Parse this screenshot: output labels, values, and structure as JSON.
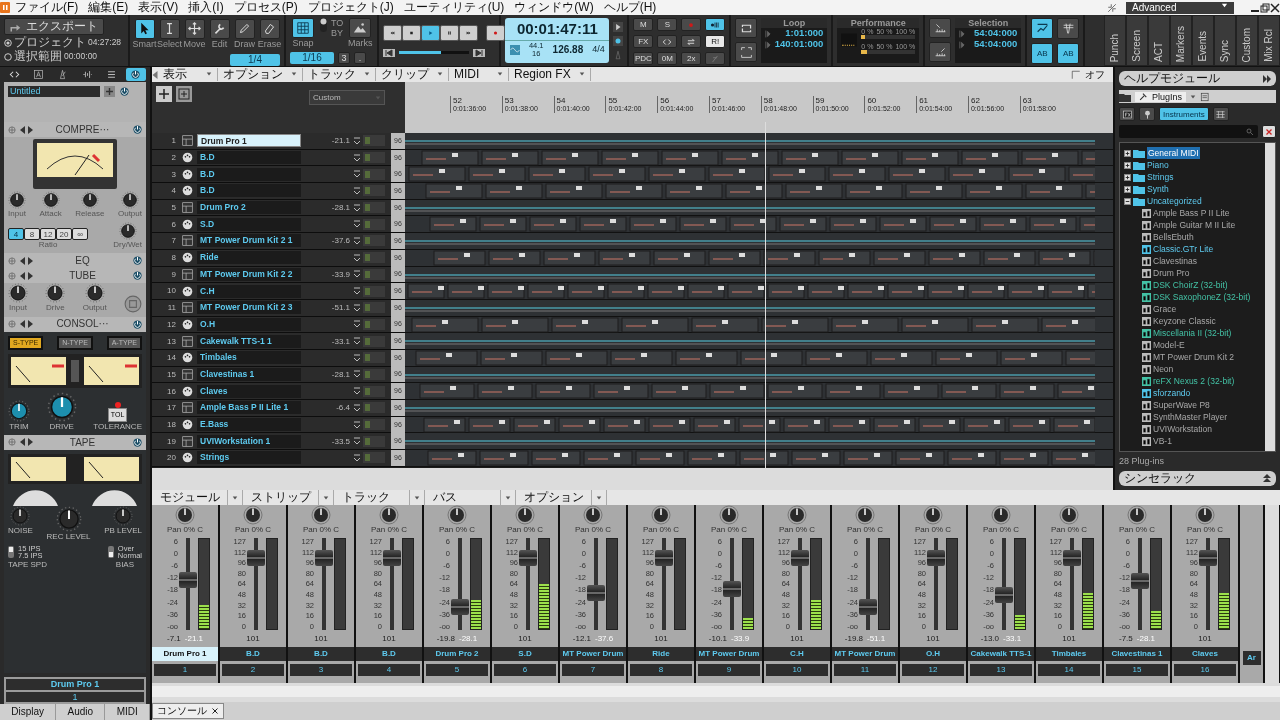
{
  "menu": [
    "ファイル(F)",
    "編集(E)",
    "表示(V)",
    "挿入(I)",
    "プロセス(P)",
    "プロジェクト(J)",
    "ユーティリティ(U)",
    "ウィンドウ(W)",
    "ヘルプ(H)"
  ],
  "workspace": {
    "label": "Advanced"
  },
  "toolbar": {
    "export": {
      "label": "エクスポート",
      "scopes": [
        {
          "label": "プロジェクト",
          "time": "04:27:28",
          "selected": true
        },
        {
          "label": "選択範囲",
          "time": "00:00:00",
          "selected": false
        }
      ]
    },
    "position": {
      "level": 0.6
    },
    "tools": [
      {
        "kind": "pointer",
        "label": "Smart",
        "selected": true
      },
      {
        "kind": "ibeam",
        "label": "Select",
        "selected": false
      },
      {
        "kind": "move",
        "label": "Move",
        "selected": false
      },
      {
        "kind": "wrench",
        "label": "Edit",
        "selected": false
      },
      {
        "kind": "pencil",
        "label": "Draw",
        "selected": false
      },
      {
        "kind": "eraser",
        "label": "Erase",
        "selected": false
      }
    ],
    "tool_resolution": "1/4",
    "snap": {
      "label": "Snap",
      "on": true,
      "to": "TO",
      "by": "BY",
      "by_mode": false,
      "resolution": "1/16",
      "triplet": "3",
      "dotted": ".",
      "marks": "Marks"
    },
    "transport": [
      {
        "kind": "rewind",
        "selected": false
      },
      {
        "kind": "stop",
        "selected": false
      },
      {
        "kind": "play",
        "selected": true
      },
      {
        "kind": "pause",
        "selected": false
      },
      {
        "kind": "forward",
        "selected": false
      }
    ],
    "record": {
      "selected": false
    },
    "now": {
      "time": "00:01:47:11",
      "sample_rate": "44.1",
      "bit_depth": "16",
      "tempo": "126.88",
      "meter": "4/4"
    },
    "mix_buttons": [
      {
        "kind": "text",
        "label": "M",
        "selected": false
      },
      {
        "kind": "text",
        "label": "S",
        "selected": false
      },
      {
        "kind": "dot",
        "selected": false
      },
      {
        "kind": "bars",
        "selected": true
      },
      {
        "kind": "text",
        "label": "FX",
        "selected": false
      },
      {
        "kind": "arrows",
        "selected": false
      },
      {
        "kind": "swap",
        "selected": false
      },
      {
        "kind": "text",
        "label": "R!",
        "selected": true
      },
      {
        "kind": "text",
        "label": "PDC",
        "selected": false
      },
      {
        "kind": "text",
        "label": "0M",
        "selected": false
      },
      {
        "kind": "text",
        "label": "2x",
        "selected": false
      },
      {
        "kind": "slash",
        "selected": false
      }
    ],
    "loop": {
      "title": "Loop",
      "start": "1:01:000",
      "end": "140:01:000"
    },
    "performance": {
      "title": "Performance",
      "meters": [
        {
          "level": 0.06,
          "scale": [
            "0 %",
            "50 %",
            "100 %"
          ]
        },
        {
          "level": 0.1,
          "scale": [
            "0 %",
            "50 %",
            "100 %"
          ]
        }
      ]
    },
    "selection": {
      "title": "Selection",
      "start": "54:04:000",
      "end": "54:04:000"
    },
    "edit_buttons": [
      {
        "label": "AB",
        "selected": true
      },
      {
        "label": "AB",
        "selected": true
      }
    ],
    "modules": [
      "Punch",
      "Screen",
      "ACT",
      "Markers",
      "Events",
      "Sync",
      "Custom",
      "Mix Rcl"
    ]
  },
  "inspector": {
    "tabs": [
      {
        "kind": "arrows",
        "selected": false
      },
      {
        "kind": "letter",
        "selected": false
      },
      {
        "kind": "metronome",
        "selected": false
      },
      {
        "kind": "wave",
        "selected": false
      },
      {
        "kind": "list",
        "selected": false
      },
      {
        "kind": "power",
        "selected": true
      }
    ],
    "project": {
      "name": "Untitled"
    },
    "fx": [
      {
        "kind": "compressor",
        "title": "COMPRE···",
        "knobs": [
          "Input",
          "Attack",
          "Release",
          "Output"
        ],
        "ratios": [
          {
            "label": "4",
            "selected": true
          },
          {
            "label": "8",
            "selected": false
          },
          {
            "label": "12",
            "selected": false
          },
          {
            "label": "20",
            "selected": false
          },
          {
            "label": "∞",
            "selected": false
          }
        ],
        "ratio_label": "Ratio",
        "mix_label": "Dry/Wet"
      },
      {
        "kind": "eq",
        "title": "EQ"
      },
      {
        "kind": "tube",
        "title": "TUBE",
        "knobs": [
          "Input",
          "Drive",
          "Output"
        ]
      },
      {
        "kind": "console",
        "title": "CONSOL···",
        "types": [
          {
            "label": "S-TYPE",
            "selected": true
          },
          {
            "label": "N-TYPE",
            "selected": false
          },
          {
            "label": "A-TYPE",
            "selected": false
          }
        ],
        "knobs": [
          "TRIM",
          "DRIVE"
        ],
        "tolerance": {
          "button": "TOL",
          "label": "TOLERANCE"
        }
      },
      {
        "kind": "tape",
        "title": "TAPE",
        "knobs": [
          "NOISE",
          "REC LEVEL",
          "PB LEVEL"
        ],
        "speed": {
          "label": "TAPE SPD",
          "options": [
            "15 IPS",
            "7.5 IPS"
          ],
          "lower": false
        },
        "bias": {
          "label": "BIAS",
          "options": [
            "Over",
            "Normal"
          ],
          "lower": true
        }
      }
    ],
    "track": {
      "name": "Drum Pro 1",
      "number": "1"
    },
    "bottom_tabs": [
      "Display",
      "Audio",
      "MIDI"
    ]
  },
  "track_view": {
    "menu": [
      "表示",
      "オプション",
      "トラック",
      "クリップ",
      "MIDI",
      "Region FX"
    ],
    "preset": "Custom",
    "snap_label": "オフ",
    "ruler": [
      {
        "measure": "52",
        "time": "0:01:36:00"
      },
      {
        "measure": "53",
        "time": "0:01:38:00"
      },
      {
        "measure": "54",
        "time": "0:01:40:00"
      },
      {
        "measure": "55",
        "time": "0:01:42:00"
      },
      {
        "measure": "56",
        "time": "0:01:44:00"
      },
      {
        "measure": "57",
        "time": "0:01:46:00"
      },
      {
        "measure": "58",
        "time": "0:01:48:00"
      },
      {
        "measure": "59",
        "time": "0:01:50:00"
      },
      {
        "measure": "60",
        "time": "0:01:52:00"
      },
      {
        "measure": "61",
        "time": "0:01:54:00"
      },
      {
        "measure": "62",
        "time": "0:01:56:00"
      },
      {
        "measure": "63",
        "time": "0:01:58:00"
      }
    ],
    "tracks": [
      {
        "number": "1",
        "name": "Drum Pro 1",
        "kind": "synth",
        "volume": "-21.1",
        "channel": "96",
        "selected": true
      },
      {
        "number": "2",
        "name": "B.D",
        "kind": "midi",
        "channel": "96",
        "selected": false
      },
      {
        "number": "3",
        "name": "B.D",
        "kind": "midi",
        "channel": "96",
        "selected": false
      },
      {
        "number": "4",
        "name": "B.D",
        "kind": "midi",
        "channel": "96",
        "selected": false
      },
      {
        "number": "5",
        "name": "Drum Pro 2",
        "kind": "synth",
        "volume": "-28.1",
        "channel": "96",
        "selected": false
      },
      {
        "number": "6",
        "name": "S.D",
        "kind": "midi",
        "channel": "96",
        "selected": false
      },
      {
        "number": "7",
        "name": "MT Power Drum Kit 2 1",
        "kind": "synth",
        "volume": "-37.6",
        "channel": "96",
        "selected": false
      },
      {
        "number": "8",
        "name": "Ride",
        "kind": "midi",
        "channel": "96",
        "selected": false
      },
      {
        "number": "9",
        "name": "MT Power Drum Kit 2 2",
        "kind": "synth",
        "volume": "-33.9",
        "channel": "96",
        "selected": false
      },
      {
        "number": "10",
        "name": "C.H",
        "kind": "midi",
        "channel": "96",
        "selected": false
      },
      {
        "number": "11",
        "name": "MT Power Drum Kit 2 3",
        "kind": "synth",
        "volume": "-51.1",
        "channel": "96",
        "selected": false
      },
      {
        "number": "12",
        "name": "O.H",
        "kind": "midi",
        "channel": "96",
        "selected": false
      },
      {
        "number": "13",
        "name": "Cakewalk TTS-1 1",
        "kind": "synth",
        "volume": "-33.1",
        "channel": "96",
        "selected": false
      },
      {
        "number": "14",
        "name": "Timbales",
        "kind": "midi",
        "channel": "96",
        "selected": false
      },
      {
        "number": "15",
        "name": "Clavestinas 1",
        "kind": "synth",
        "volume": "-28.1",
        "channel": "96",
        "selected": false
      },
      {
        "number": "16",
        "name": "Claves",
        "kind": "midi",
        "channel": "96",
        "selected": false
      },
      {
        "number": "17",
        "name": "Ample Bass P II Lite 1",
        "kind": "synth",
        "volume": "-6.4",
        "channel": "96",
        "selected": false
      },
      {
        "number": "18",
        "name": "E.Bass",
        "kind": "midi",
        "channel": "96",
        "selected": false
      },
      {
        "number": "19",
        "name": "UVIWorkstation 1",
        "kind": "synth",
        "volume": "-33.5",
        "channel": "96",
        "selected": false
      },
      {
        "number": "20",
        "name": "Strings",
        "kind": "midi",
        "channel": "96",
        "selected": false
      }
    ]
  },
  "browser": {
    "title": "ヘルプモジュール",
    "tab": "PlugIns",
    "filters": [
      {
        "kind": "fx",
        "selected": false
      },
      {
        "kind": "synth",
        "selected": false
      },
      {
        "kind": "text",
        "label": "Instruments",
        "selected": true
      },
      {
        "kind": "routing",
        "selected": false
      }
    ],
    "tree": [
      {
        "label": "General MIDI",
        "selected": true,
        "expanded": false
      },
      {
        "label": "Piano",
        "selected": false,
        "expanded": false
      },
      {
        "label": "Strings",
        "selected": false,
        "expanded": false
      },
      {
        "label": "Synth",
        "selected": false,
        "expanded": false
      },
      {
        "label": "Uncategorized",
        "selected": false,
        "expanded": true,
        "children": [
          {
            "label": "Ample Bass P II Lite",
            "kind": "plain"
          },
          {
            "label": "Ample Guitar M II Lite",
            "kind": "plain"
          },
          {
            "label": "BellsEbuth",
            "kind": "plain"
          },
          {
            "label": "Classic.GTr Lite",
            "kind": "accent"
          },
          {
            "label": "Clavestinas",
            "kind": "plain"
          },
          {
            "label": "Drum Pro",
            "kind": "plain"
          },
          {
            "label": "DSK ChoirZ (32-bit)",
            "kind": "bridged"
          },
          {
            "label": "DSK SaxophoneZ (32-bit)",
            "kind": "bridged"
          },
          {
            "label": "Grace",
            "kind": "plain"
          },
          {
            "label": "Keyzone Classic",
            "kind": "plain"
          },
          {
            "label": "Miscellania II (32-bit)",
            "kind": "bridged"
          },
          {
            "label": "Model-E",
            "kind": "plain"
          },
          {
            "label": "MT Power Drum Kit 2",
            "kind": "plain"
          },
          {
            "label": "Neon",
            "kind": "plain"
          },
          {
            "label": "reFX Nexus 2 (32-bit)",
            "kind": "bridged"
          },
          {
            "label": "sforzando",
            "kind": "accent"
          },
          {
            "label": "SuperWave P8",
            "kind": "plain"
          },
          {
            "label": "SynthMaster Player",
            "kind": "plain"
          },
          {
            "label": "UVIWorkstation",
            "kind": "plain"
          },
          {
            "label": "VB-1",
            "kind": "plain"
          }
        ]
      }
    ],
    "count": "28 Plug-ins",
    "rack": "シンセラック"
  },
  "mixer": {
    "menu": [
      "モジュール",
      "ストリップ",
      "トラック",
      "バス",
      "オプション"
    ],
    "strips": [
      {
        "number": "1",
        "name": "Drum Pro 1",
        "kind": "audio",
        "pan": "Pan 0% C",
        "scale": [
          "6",
          "0",
          "-6",
          "-12",
          "-18",
          "-24",
          "-36",
          "-oo"
        ],
        "fader": {
          "level": 0.55
        },
        "volume": "-7.1",
        "peak": "-21.1",
        "meter": {
          "level": 0.27
        },
        "selected": true
      },
      {
        "number": "2",
        "name": "B.D",
        "kind": "midi",
        "pan": "Pan 0% C",
        "scale": [
          "127",
          "112",
          "96",
          "80",
          "64",
          "48",
          "32",
          "16",
          "0"
        ],
        "fader": {
          "level": 0.79
        },
        "volume": "101",
        "meter": {
          "level": 0
        },
        "selected": false
      },
      {
        "number": "3",
        "name": "B.D",
        "kind": "midi",
        "pan": "Pan 0% C",
        "scale": [
          "127",
          "112",
          "96",
          "80",
          "64",
          "48",
          "32",
          "16",
          "0"
        ],
        "fader": {
          "level": 0.79
        },
        "volume": "101",
        "meter": {
          "level": 0
        },
        "selected": false
      },
      {
        "number": "4",
        "name": "B.D",
        "kind": "midi",
        "pan": "Pan 0% C",
        "scale": [
          "127",
          "112",
          "96",
          "80",
          "64",
          "48",
          "32",
          "16",
          "0"
        ],
        "fader": {
          "level": 0.79
        },
        "volume": "101",
        "meter": {
          "level": 0
        },
        "selected": false
      },
      {
        "number": "5",
        "name": "Drum Pro 2",
        "kind": "audio",
        "pan": "Pan 0% C",
        "scale": [
          "6",
          "0",
          "-6",
          "-12",
          "-18",
          "-24",
          "-36",
          "-oo"
        ],
        "fader": {
          "level": 0.25
        },
        "volume": "-19.8",
        "peak": "-28.1",
        "meter": {
          "level": 0.32
        },
        "selected": false
      },
      {
        "number": "6",
        "name": "S.D",
        "kind": "midi",
        "pan": "Pan 0% C",
        "scale": [
          "127",
          "112",
          "96",
          "80",
          "64",
          "48",
          "32",
          "16",
          "0"
        ],
        "fader": {
          "level": 0.79
        },
        "volume": "101",
        "meter": {
          "level": 0.5
        },
        "selected": false
      },
      {
        "number": "7",
        "name": "MT Power Drum",
        "kind": "audio",
        "pan": "Pan 0% C",
        "scale": [
          "6",
          "0",
          "-6",
          "-12",
          "-18",
          "-24",
          "-36",
          "-oo"
        ],
        "fader": {
          "level": 0.4
        },
        "volume": "-12.1",
        "peak": "-37.6",
        "meter": {
          "level": 0
        },
        "selected": false
      },
      {
        "number": "8",
        "name": "Ride",
        "kind": "midi",
        "pan": "Pan 0% C",
        "scale": [
          "127",
          "112",
          "96",
          "80",
          "64",
          "48",
          "32",
          "16",
          "0"
        ],
        "fader": {
          "level": 0.79
        },
        "volume": "101",
        "meter": {
          "level": 0
        },
        "selected": false
      },
      {
        "number": "9",
        "name": "MT Power Drum",
        "kind": "audio",
        "pan": "Pan 0% C",
        "scale": [
          "6",
          "0",
          "-6",
          "-12",
          "-18",
          "-24",
          "-36",
          "-oo"
        ],
        "fader": {
          "level": 0.45
        },
        "volume": "-10.1",
        "peak": "-33.9",
        "meter": {
          "level": 0.12
        },
        "selected": false
      },
      {
        "number": "10",
        "name": "C.H",
        "kind": "midi",
        "pan": "Pan 0% C",
        "scale": [
          "127",
          "112",
          "96",
          "80",
          "64",
          "48",
          "32",
          "16",
          "0"
        ],
        "fader": {
          "level": 0.79
        },
        "volume": "101",
        "meter": {
          "level": 0.32
        },
        "selected": false
      },
      {
        "number": "11",
        "name": "MT Power Drum",
        "kind": "audio",
        "pan": "Pan 0% C",
        "scale": [
          "6",
          "0",
          "-6",
          "-12",
          "-18",
          "-24",
          "-36",
          "-oo"
        ],
        "fader": {
          "level": 0.25
        },
        "volume": "-19.8",
        "peak": "-51.1",
        "meter": {
          "level": 0
        },
        "selected": false
      },
      {
        "number": "12",
        "name": "O.H",
        "kind": "midi",
        "pan": "Pan 0% C",
        "scale": [
          "127",
          "112",
          "96",
          "80",
          "64",
          "48",
          "32",
          "16",
          "0"
        ],
        "fader": {
          "level": 0.79
        },
        "volume": "101",
        "meter": {
          "level": 0
        },
        "selected": false
      },
      {
        "number": "13",
        "name": "Cakewalk TTS-1",
        "kind": "audio",
        "pan": "Pan 0% C",
        "scale": [
          "6",
          "0",
          "-6",
          "-12",
          "-18",
          "-24",
          "-36",
          "-oo"
        ],
        "fader": {
          "level": 0.38
        },
        "volume": "-13.0",
        "peak": "-33.1",
        "meter": {
          "level": 0.16
        },
        "selected": false
      },
      {
        "number": "14",
        "name": "Timbales",
        "kind": "midi",
        "pan": "Pan 0% C",
        "scale": [
          "127",
          "112",
          "96",
          "80",
          "64",
          "48",
          "32",
          "16",
          "0"
        ],
        "fader": {
          "level": 0.79
        },
        "volume": "101",
        "meter": {
          "level": 0.4
        },
        "selected": false
      },
      {
        "number": "15",
        "name": "Clavestinas 1",
        "kind": "audio",
        "pan": "Pan 0% C",
        "scale": [
          "6",
          "0",
          "-6",
          "-12",
          "-18",
          "-24",
          "-36",
          "-oo"
        ],
        "fader": {
          "level": 0.53
        },
        "volume": "-7.5",
        "peak": "-28.1",
        "meter": {
          "level": 0.2
        },
        "selected": false
      },
      {
        "number": "16",
        "name": "Claves",
        "kind": "midi",
        "pan": "Pan 0% C",
        "scale": [
          "127",
          "112",
          "96",
          "80",
          "64",
          "48",
          "32",
          "16",
          "0"
        ],
        "fader": {
          "level": 0.79
        },
        "volume": "101",
        "meter": {
          "level": 0.4
        },
        "selected": false
      },
      {
        "name": "Ar",
        "kind": "partial"
      }
    ],
    "tab": "コンソール"
  }
}
